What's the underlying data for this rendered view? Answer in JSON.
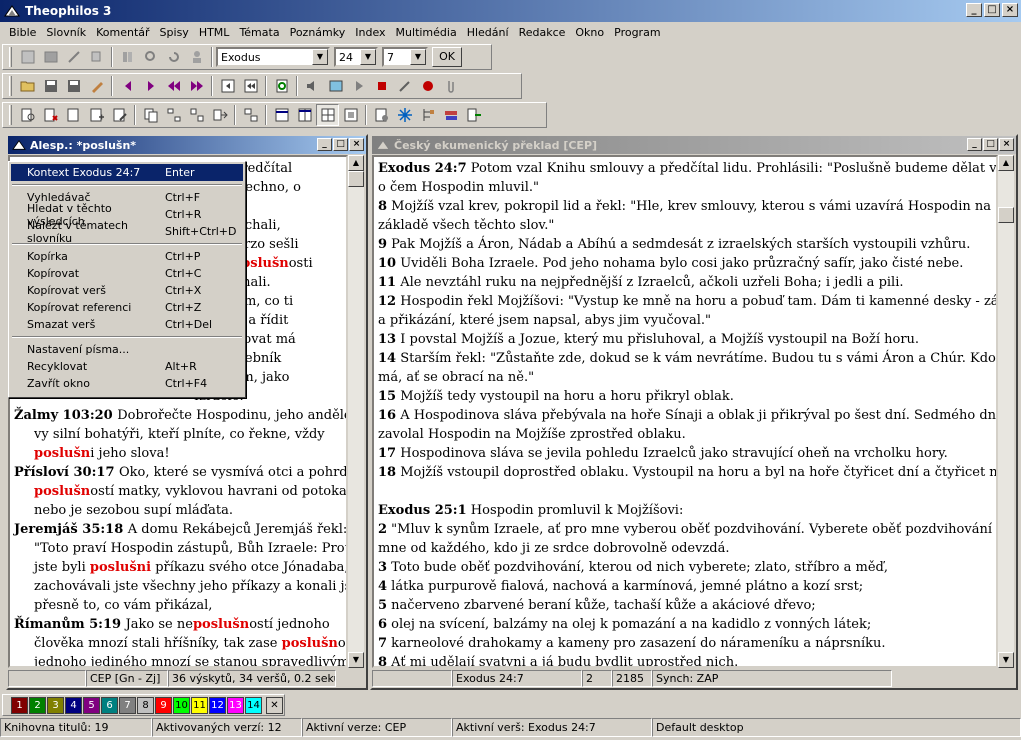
{
  "app_title": "Theophilos 3",
  "menu": [
    "Bible",
    "Slovník",
    "Komentář",
    "Spisy",
    "HTML",
    "Témata",
    "Poznámky",
    "Index",
    "Multimédia",
    "Hledání",
    "Redakce",
    "Okno",
    "Program"
  ],
  "toolbar": {
    "book_select": "Exodus",
    "chapter_select": "24",
    "verse_select": "7",
    "ok_label": "OK"
  },
  "left_pane": {
    "title": "Alesp.: *poslušn*",
    "visible_lines": [
      {
        "ref": "",
        "parts": [
          {
            "t": "uvy a předčítal"
          }
        ]
      },
      {
        "ref": "",
        "parts": [
          {
            "t": "dělat všechno, o"
          }
        ]
      },
      {
        "ref": "",
        "parts": [
          {
            "t": ""
          }
        ]
      },
      {
        "ref": "",
        "parts": [
          {
            "t": "eposlouchali,"
          }
        ]
      },
      {
        "ref": "",
        "parts": [
          {
            "t": "e jim. Brzo sešli"
          }
        ]
      },
      {
        "ref": "",
        "parts": [
          {
            "t": "ové v "
          },
          {
            "t": "poslušn",
            "h": true
          },
          {
            "t": "osti"
          }
        ]
      },
      {
        "ref": "",
        "parts": [
          {
            "t": "k nejednali."
          }
        ]
      },
      {
        "ref": "",
        "parts": [
          {
            "t": "i",
            "h": true
          },
          {
            "t": " ve všem, co ti"
          }
        ]
      },
      {
        "ref": "",
        "parts": [
          {
            "t": "cestách a řídit"
          }
        ]
      },
      {
        "ref": "",
        "parts": [
          {
            "t": "a dodržovat má"
          }
        ]
      },
      {
        "ref": "",
        "parts": [
          {
            "t": "mů služebník"
          }
        ]
      },
      {
        "ref": "",
        "parts": [
          {
            "t": "valý dům, jako"
          }
        ]
      },
      {
        "ref": "",
        "parts": [
          {
            "t": "Izraele."
          }
        ]
      }
    ],
    "entries": [
      {
        "ref": "Žalmy 103:20",
        "lines": [
          [
            {
              "t": "Dobrořečte Hospodinu, jeho andělé,"
            }
          ],
          [
            {
              "t": "vy silní bohatýři, kteří plníte, co řekne, vždy"
            }
          ],
          [
            {
              "t": "poslušn",
              "h": true
            },
            {
              "t": "i jeho slova!"
            }
          ]
        ]
      },
      {
        "ref": "Přísloví 30:17",
        "lines": [
          [
            {
              "t": "Oko, které se vysmívá otci a pohrdá"
            }
          ],
          [
            {
              "t": "poslušn",
              "h": true
            },
            {
              "t": "ostí matky, vyklovou havrani od potoka,"
            }
          ],
          [
            {
              "t": "nebo je sezobou supí mláďata."
            }
          ]
        ]
      },
      {
        "ref": "Jeremjáš 35:18",
        "lines": [
          [
            {
              "t": "A domu Rekábejců Jeremjáš řekl:"
            }
          ],
          [
            {
              "t": "\"Toto praví Hospodin zástupů, Bůh Izraele: Protože"
            }
          ],
          [
            {
              "t": "jste byli "
            },
            {
              "t": "poslušn",
              "h": true
            },
            {
              "t": "i",
              "h": true
            },
            {
              "t": " příkazu svého otce Jónadaba,"
            }
          ],
          [
            {
              "t": "zachovávali jste všechny jeho příkazy a konali jste"
            }
          ],
          [
            {
              "t": "přesně to, co vám přikázal,"
            }
          ]
        ]
      },
      {
        "ref": "Římanům 5:19",
        "lines": [
          [
            {
              "t": "Jako se ne"
            },
            {
              "t": "poslušn",
              "h": true
            },
            {
              "t": "ostí jednoho"
            }
          ],
          [
            {
              "t": "člověka mnozí stali hříšníky, tak zase "
            },
            {
              "t": "poslušn",
              "h": true
            },
            {
              "t": "ostí"
            }
          ],
          [
            {
              "t": "jednoho jediného mnozí se stanou spravedlivými."
            }
          ]
        ]
      }
    ],
    "status": [
      "CEP [Gn - Zj]",
      "36 výskytů, 34 veršů, 0.2 sekun"
    ]
  },
  "context_menu": [
    {
      "label": "Kontext Exodus 24:7",
      "shortcut": "Enter",
      "selected": true
    },
    {
      "sep": true
    },
    {
      "label": "Vyhledávač",
      "shortcut": "Ctrl+F"
    },
    {
      "label": "Hledat v těchto výsledcích",
      "shortcut": "Ctrl+R"
    },
    {
      "label": "Nalézt v tématech slovníku",
      "shortcut": "Shift+Ctrl+D"
    },
    {
      "sep": true
    },
    {
      "label": "Kopírka",
      "shortcut": "Ctrl+P"
    },
    {
      "label": "Kopírovat",
      "shortcut": "Ctrl+C"
    },
    {
      "label": "Kopírovat verš",
      "shortcut": "Ctrl+X"
    },
    {
      "label": "Kopírovat referenci",
      "shortcut": "Ctrl+Z"
    },
    {
      "label": "Smazat verš",
      "shortcut": "Ctrl+Del"
    },
    {
      "sep": true
    },
    {
      "label": "Nastavení písma...",
      "shortcut": ""
    },
    {
      "label": "Recyklovat",
      "shortcut": "Alt+R"
    },
    {
      "label": "Zavřít okno",
      "shortcut": "Ctrl+F4"
    }
  ],
  "right_pane": {
    "title": "Český ekumenický překlad [CEP]",
    "lines": [
      [
        {
          "b": "Exodus 24:7"
        },
        {
          "t": "  Potom vzal Knihu smlouvy a předčítal lidu. Prohlásili: \"Poslušně budeme dělat všechno,"
        }
      ],
      [
        {
          "t": "o čem Hospodin mluvil.\""
        }
      ],
      [
        {
          "b": "8"
        },
        {
          "t": "  Mojžíš vzal krev, pokropil lid a řekl: \"Hle, krev smlouvy, kterou s vámi uzavírá Hospodin na"
        }
      ],
      [
        {
          "t": "základě všech těchto slov.\""
        }
      ],
      [
        {
          "b": "9"
        },
        {
          "t": "  Pak Mojžíš a Áron, Nádab a Abíhú a sedmdesát z izraelských starších vystoupili vzhůru."
        }
      ],
      [
        {
          "b": "10"
        },
        {
          "t": "  Uviděli Boha Izraele. Pod jeho nohama bylo cosi jako průzračný safír, jako čisté nebe."
        }
      ],
      [
        {
          "b": "11"
        },
        {
          "t": "  Ale nevztáhl ruku na nejpřednější z Izraelců, ačkoli uzřeli Boha; i jedli a pili."
        }
      ],
      [
        {
          "b": "12"
        },
        {
          "t": "  Hospodin řekl Mojžíšovi: \"Vystup ke mně na horu a pobuď tam. Dám ti kamenné desky - zákon"
        }
      ],
      [
        {
          "t": "a přikázání, které jsem napsal, abys jim vyučoval.\""
        }
      ],
      [
        {
          "b": "13"
        },
        {
          "t": "  I povstal Mojžíš a Jozue, který mu přisluhoval, a Mojžíš vystoupil na Boží horu."
        }
      ],
      [
        {
          "b": "14"
        },
        {
          "t": "  Starším řekl: \"Zůstaňte zde, dokud se k vám nevrátíme. Budou tu s vámi Áron a Chúr. Kdo něco"
        }
      ],
      [
        {
          "t": "má, ať se obrací na ně.\""
        }
      ],
      [
        {
          "b": "15"
        },
        {
          "t": "  Mojžíš tedy vystoupil na horu a horu přikryl oblak."
        }
      ],
      [
        {
          "b": "16"
        },
        {
          "t": "  A Hospodinova sláva přebývala na hoře Sínaji a oblak ji přikrýval po šest dní. Sedmého dne"
        }
      ],
      [
        {
          "t": "zavolal Hospodin na Mojžíše zprostřed oblaku."
        }
      ],
      [
        {
          "b": "17"
        },
        {
          "t": "  Hospodinova sláva se jevila pohledu Izraelců jako stravující oheň na vrcholku hory."
        }
      ],
      [
        {
          "b": "18"
        },
        {
          "t": "  Mojžíš vstoupil doprostřed oblaku. Vystoupil na horu a byl na hoře čtyřicet dní a čtyřicet nocí."
        }
      ],
      [
        {
          "t": ""
        }
      ],
      [
        {
          "b": "Exodus 25:1"
        },
        {
          "t": "  Hospodin promluvil k Mojžíšovi:"
        }
      ],
      [
        {
          "b": "2"
        },
        {
          "t": "  \"Mluv k synům Izraele, ať pro mne vyberou oběť pozdvihování. Vyberete oběť pozdvihování pro"
        }
      ],
      [
        {
          "t": "mne od každého, kdo ji ze srdce dobrovolně odevzdá."
        }
      ],
      [
        {
          "b": "3"
        },
        {
          "t": "  Toto bude oběť pozdvihování, kterou od nich vyberete; zlato, stříbro a měď,"
        }
      ],
      [
        {
          "b": "4"
        },
        {
          "t": "  látka purpurově fialová, nachová a karmínová, jemné plátno a kozí srst;"
        }
      ],
      [
        {
          "b": "5"
        },
        {
          "t": "  načerveno zbarvené beraní kůže, tachaší kůže a akáciové dřevo;"
        }
      ],
      [
        {
          "b": "6"
        },
        {
          "t": "  olej na svícení, balzámy na olej k pomazání a na kadidlo z vonných látek;"
        }
      ],
      [
        {
          "b": "7"
        },
        {
          "t": "  karneolové drahokamy a kameny pro zasazení do nárameníku a náprsníku."
        }
      ],
      [
        {
          "b": "8"
        },
        {
          "t": "  Ať mi udělají svatyni a já budu bydlit uprostřed nich."
        }
      ]
    ],
    "status": [
      "",
      "Exodus 24:7",
      "2",
      "2185",
      "Synch: ZAP"
    ]
  },
  "color_buttons": [
    {
      "n": "1",
      "c": "#800000"
    },
    {
      "n": "2",
      "c": "#008000"
    },
    {
      "n": "3",
      "c": "#808000"
    },
    {
      "n": "4",
      "c": "#000080"
    },
    {
      "n": "5",
      "c": "#800080"
    },
    {
      "n": "6",
      "c": "#008080"
    },
    {
      "n": "7",
      "c": "#808080"
    },
    {
      "n": "8",
      "c": "#c0c0c0"
    },
    {
      "n": "9",
      "c": "#ff0000"
    },
    {
      "n": "10",
      "c": "#00ff00"
    },
    {
      "n": "11",
      "c": "#ffff00"
    },
    {
      "n": "12",
      "c": "#0000ff"
    },
    {
      "n": "13",
      "c": "#ff00ff"
    },
    {
      "n": "14",
      "c": "#00ffff"
    }
  ],
  "bottom_status": [
    "Knihovna titulů: 19",
    "Aktivovaných verzí: 12",
    "Aktivní verze: CEP",
    "Aktivní verš: Exodus 24:7",
    "Default desktop"
  ]
}
